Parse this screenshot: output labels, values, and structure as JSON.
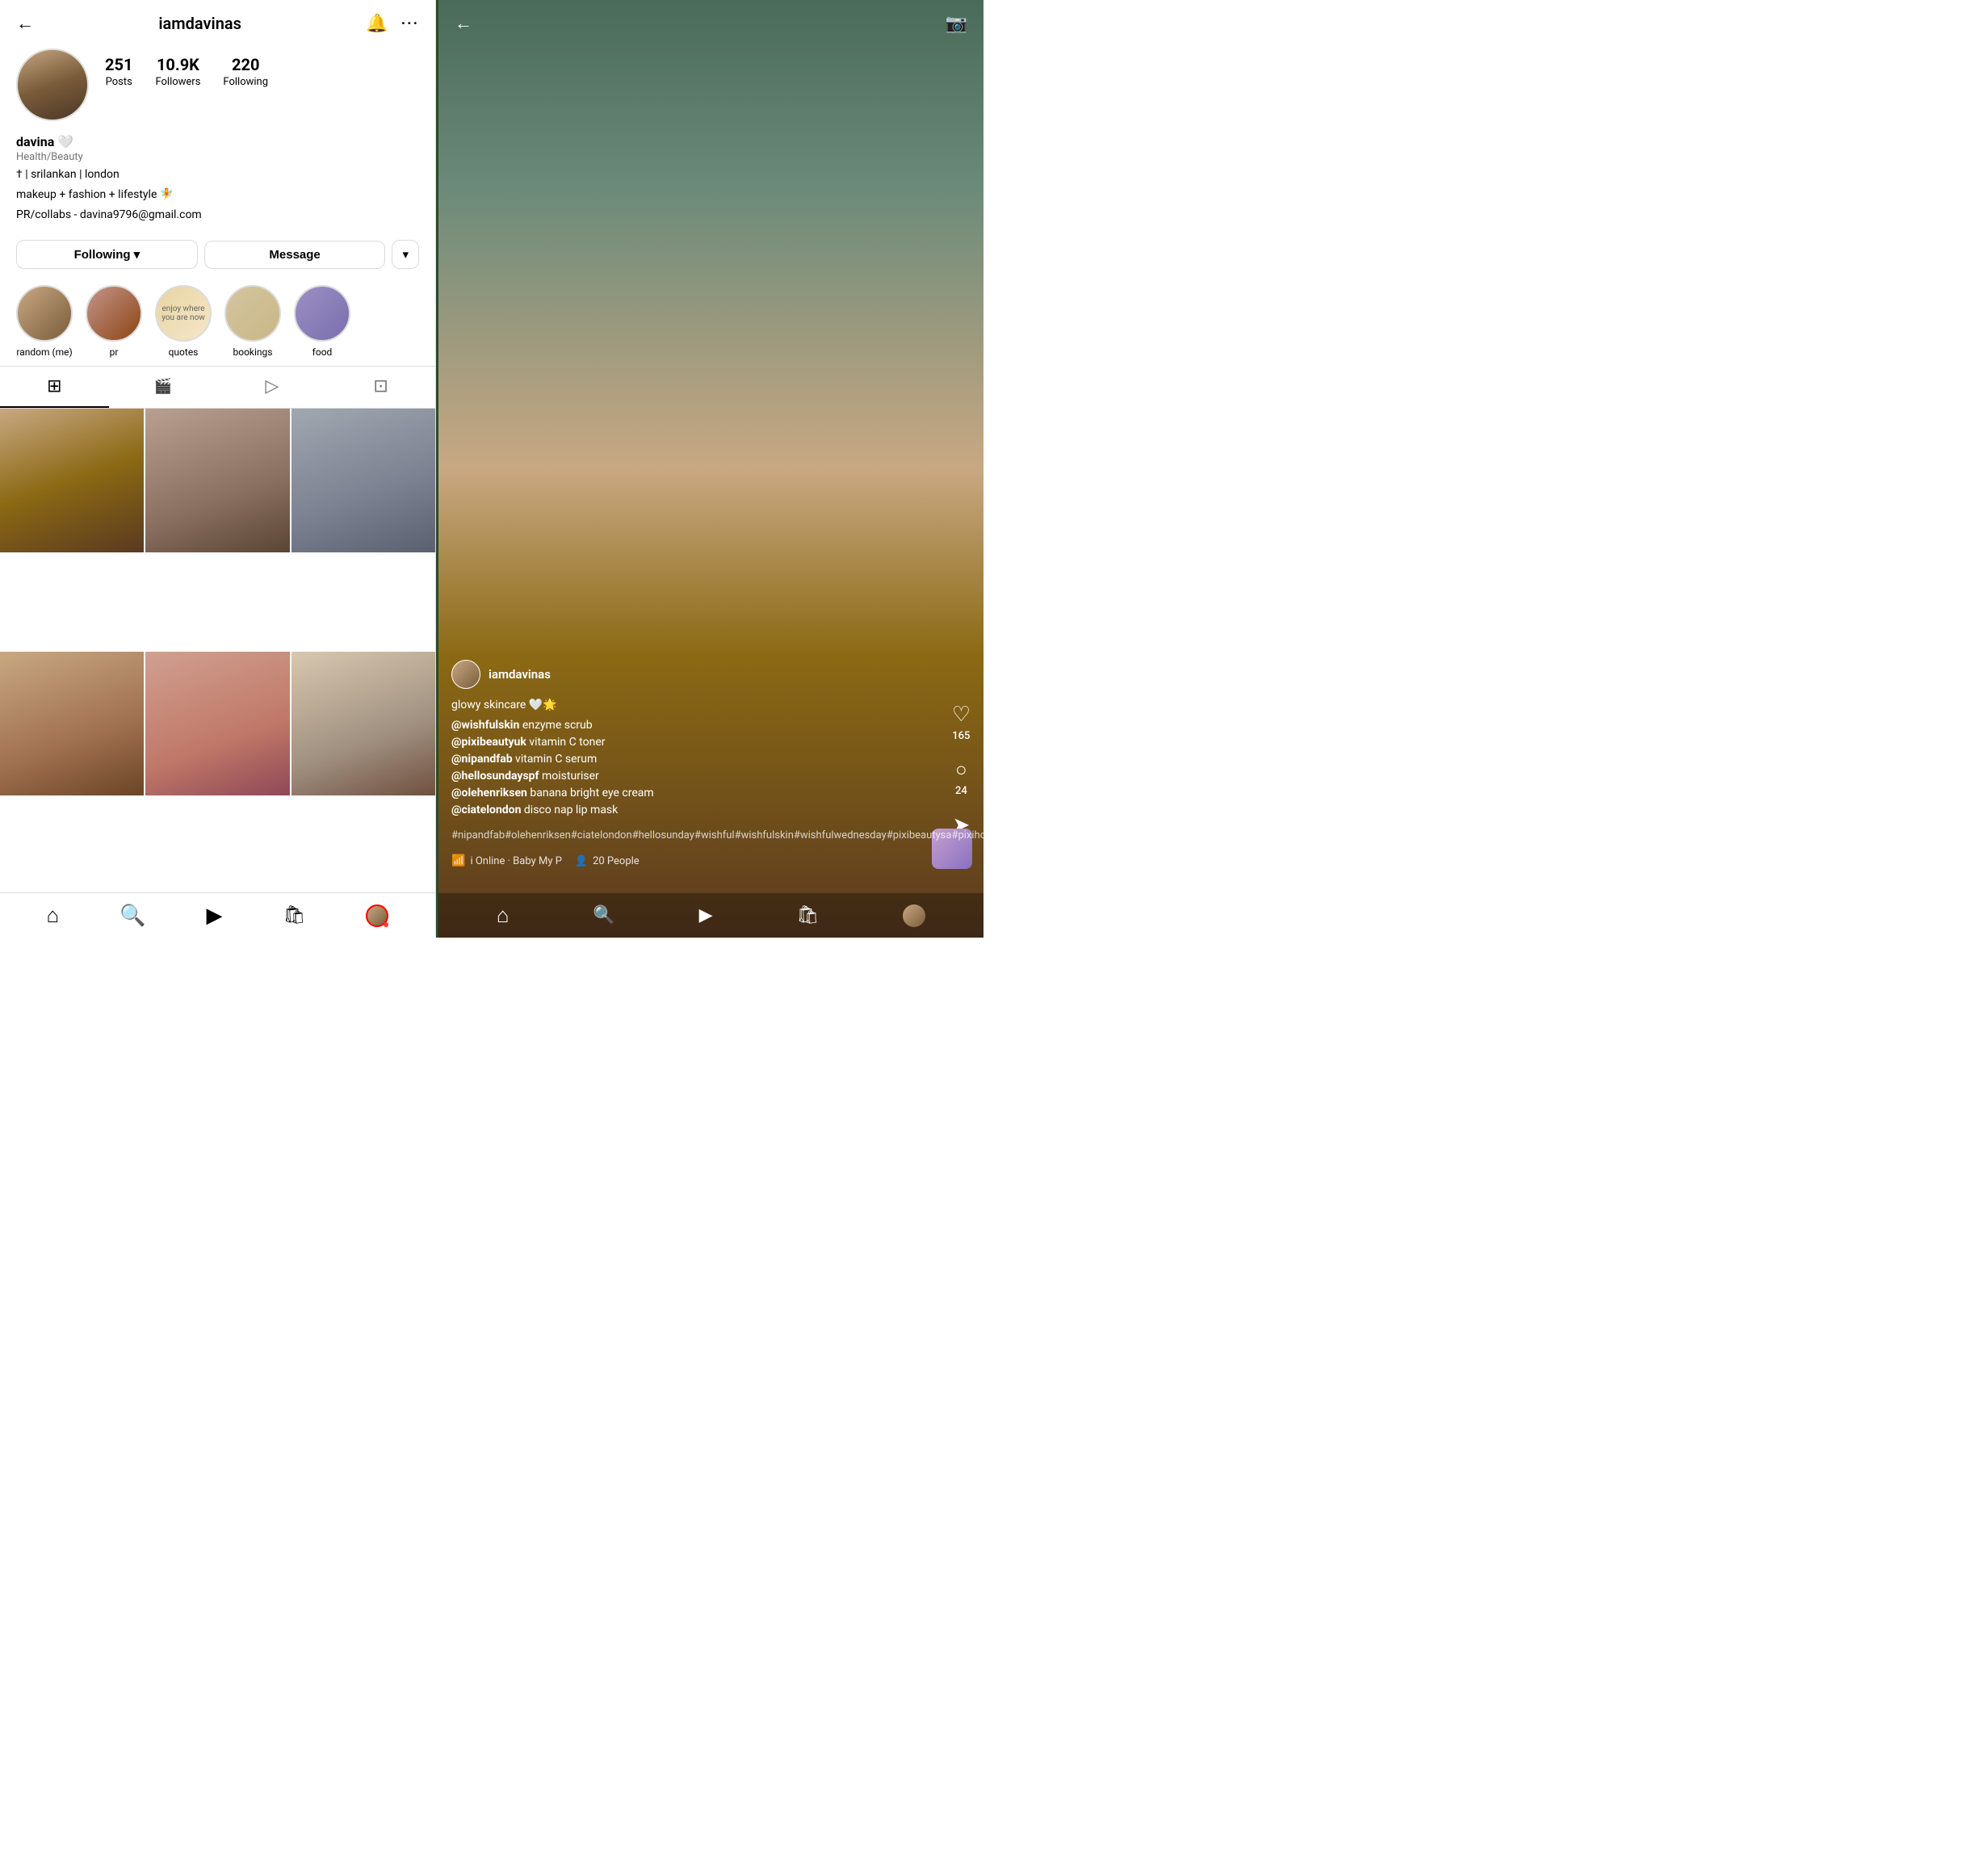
{
  "left": {
    "header": {
      "back_icon": "←",
      "username": "iamdavinas",
      "notification_icon": "🔔",
      "more_icon": "···"
    },
    "stats": {
      "posts_count": "251",
      "posts_label": "Posts",
      "followers_count": "10.9K",
      "followers_label": "Followers",
      "following_count": "220",
      "following_label": "Following"
    },
    "bio": {
      "name": "davina",
      "heart_emoji": "🤍",
      "category": "Health/Beauty",
      "line1": "† | srilankan | london",
      "line2": "makeup + fashion + lifestyle 🧚",
      "line3": "PR/collabs - davina9796@gmail.com"
    },
    "buttons": {
      "following_label": "Following",
      "following_arrow": "▾",
      "message_label": "Message",
      "dropdown_arrow": "▾"
    },
    "highlights": [
      {
        "id": "random-me",
        "label": "random (me)",
        "style": "random-me"
      },
      {
        "id": "pr",
        "label": "pr",
        "style": "pr"
      },
      {
        "id": "quotes",
        "label": "quotes",
        "style": "quotes"
      },
      {
        "id": "bookings",
        "label": "bookings",
        "style": "bookings"
      },
      {
        "id": "food",
        "label": "food",
        "style": "food"
      }
    ],
    "tabs": [
      {
        "id": "grid",
        "icon": "⊞",
        "active": true
      },
      {
        "id": "reels",
        "icon": "🎬",
        "active": false
      },
      {
        "id": "play",
        "icon": "▷",
        "active": false
      },
      {
        "id": "tag",
        "icon": "⊡",
        "active": false
      }
    ],
    "bottom_nav": [
      {
        "id": "home",
        "icon": "⌂"
      },
      {
        "id": "search",
        "icon": "⚲"
      },
      {
        "id": "reels",
        "icon": "▶"
      },
      {
        "id": "shop",
        "icon": "🛍"
      },
      {
        "id": "profile",
        "icon": "avatar"
      }
    ]
  },
  "right": {
    "header": {
      "back_icon": "←",
      "camera_icon": "📷"
    },
    "reel": {
      "username": "iamdavinas",
      "title": "glowy skincare 🤍🌟",
      "caption_lines": [
        {
          "mention": "@wishfulskin",
          "text": " enzyme scrub"
        },
        {
          "mention": "@pixibeautyuk",
          "text": " vitamin C toner"
        },
        {
          "mention": "@nipandfab",
          "text": " vitamin C serum"
        },
        {
          "mention": "@hellosundayspf",
          "text": " moisturiser"
        },
        {
          "mention": "@olehenriksen",
          "text": " banana bright eye cream"
        },
        {
          "mention": "@ciatelondon",
          "text": " disco nap lip mask"
        }
      ],
      "hashtags": "#nipandfab#olehenriksen#ciatelondon#hellosunday#wishful#wishfulskin#wishfulwednesday#pixibeautysa#pixihouseofglow#pixibeau",
      "status_signal": "📶",
      "status_online": "i Online · Baby My P",
      "status_people_icon": "👤",
      "status_people": "20 People"
    },
    "actions": {
      "like_icon": "♡",
      "like_count": "165",
      "comment_icon": "💬",
      "comment_count": "24",
      "share_icon": "➤",
      "more_icon": "···"
    }
  }
}
